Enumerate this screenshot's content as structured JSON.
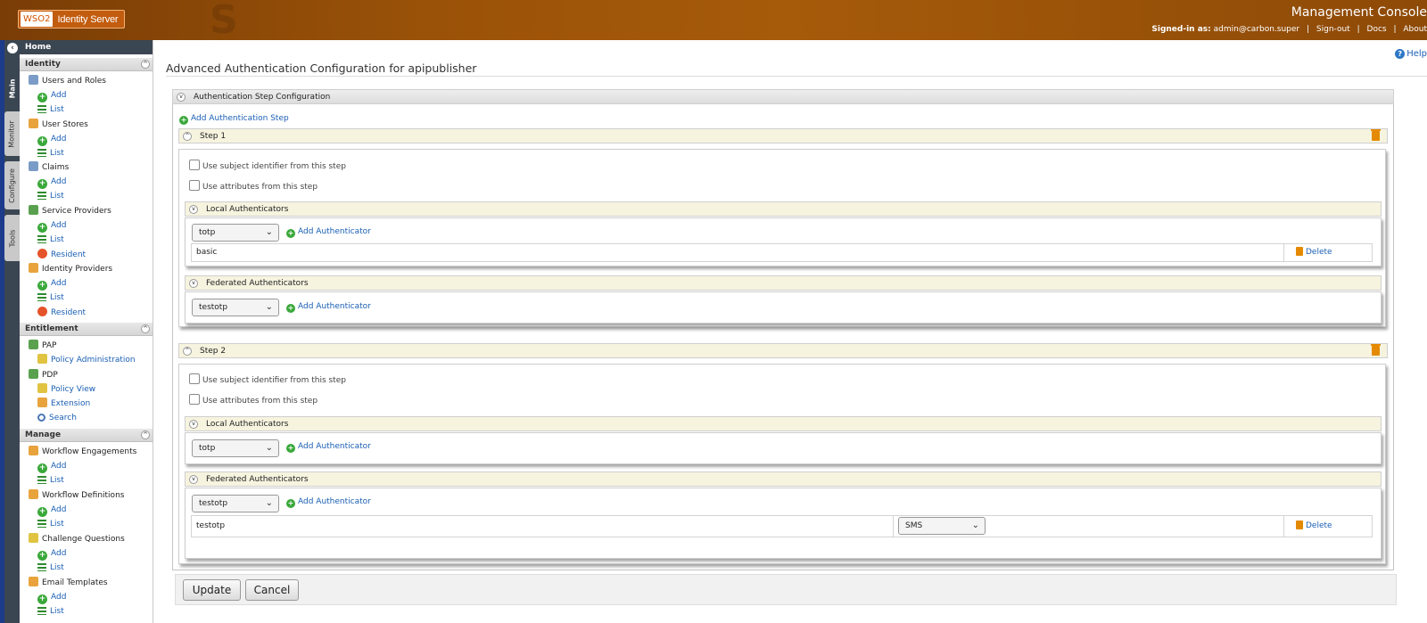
{
  "header": {
    "logo_brand": "WSO2",
    "product": "Identity Server",
    "console_title": "Management Console",
    "signed_in_label": "Signed-in as:",
    "user": "admin@carbon.super",
    "signout": "Sign-out",
    "docs": "Docs",
    "about": "About"
  },
  "left_tabs": [
    "Main",
    "Monitor",
    "Configure",
    "Tools"
  ],
  "sidebar": {
    "home": "Home",
    "identity": {
      "title": "Identity",
      "users_roles": "Users and Roles",
      "user_stores": "User Stores",
      "claims": "Claims",
      "service_providers": "Service Providers",
      "identity_providers": "Identity Providers"
    },
    "entitlement": {
      "title": "Entitlement",
      "pap": "PAP",
      "policy_admin": "Policy Administration",
      "pdp": "PDP",
      "policy_view": "Policy View",
      "extension": "Extension",
      "search": "Search"
    },
    "manage": {
      "title": "Manage",
      "workflow_engagements": "Workflow Engagements",
      "workflow_definitions": "Workflow Definitions",
      "challenge_questions": "Challenge Questions",
      "email_templates": "Email Templates"
    },
    "add": "Add",
    "list": "List",
    "resident": "Resident"
  },
  "main": {
    "title": "Advanced Authentication Configuration for apipublisher",
    "help": "Help",
    "panel_title": "Authentication Step Configuration",
    "add_step": "Add Authentication Step",
    "use_subject": "Use subject identifier from this step",
    "use_attributes": "Use attributes from this step",
    "local_auth": "Local Authenticators",
    "fed_auth": "Federated Authenticators",
    "add_authenticator": "Add Authenticator",
    "delete": "Delete",
    "step1": {
      "label": "Step 1",
      "local_select": "totp",
      "local_row": "basic",
      "fed_select": "testotp"
    },
    "step2": {
      "label": "Step 2",
      "local_select": "totp",
      "fed_select": "testotp",
      "fed_row": "testotp",
      "fed_row_select": "SMS"
    },
    "update": "Update",
    "cancel": "Cancel"
  },
  "colors": {
    "header": "#9a5208",
    "sidebar_dark": "#3b4653",
    "link": "#1a5fb4",
    "cream": "#f6f3df"
  }
}
